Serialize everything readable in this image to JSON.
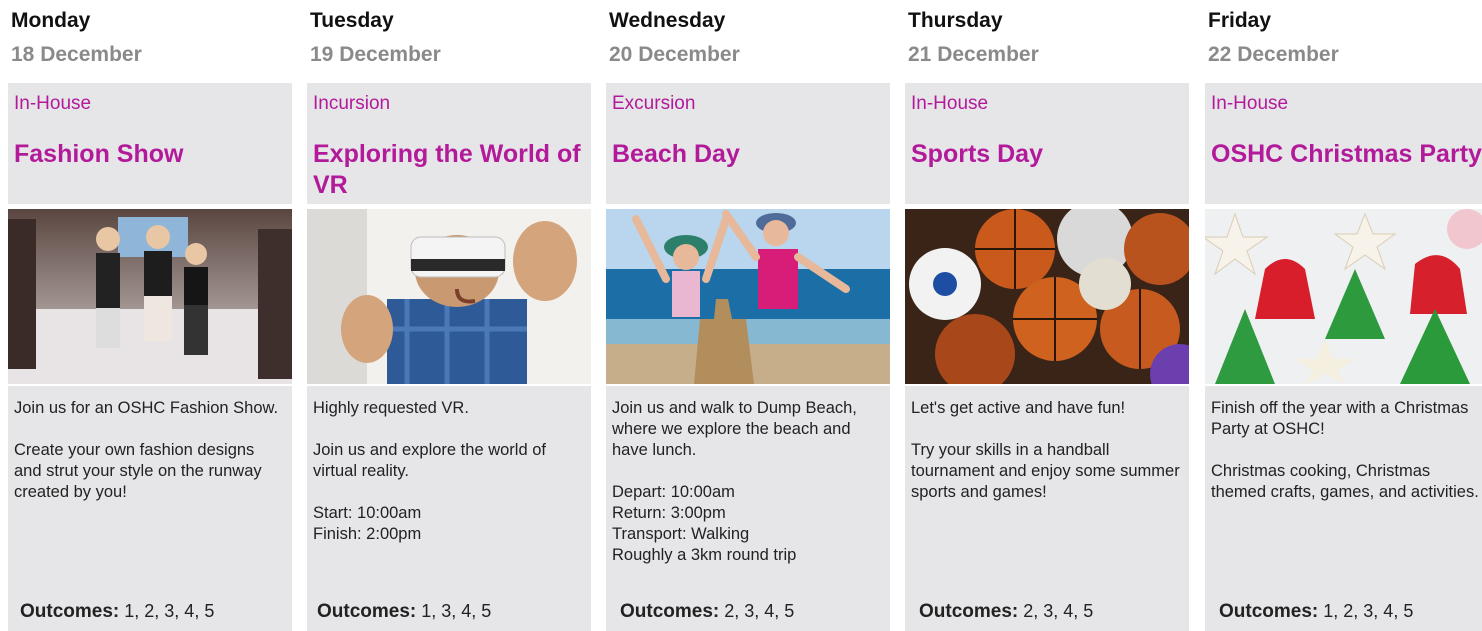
{
  "outcomes_label": "Outcomes:",
  "days": [
    {
      "day": "Monday",
      "date": "18 December",
      "category": "In-House",
      "title": "Fashion Show",
      "image": "kids-fashion-runway-photo",
      "paragraphs": [
        "Join us for an OSHC Fashion Show.",
        "Create your own fashion designs and strut your style on the runway created by you!"
      ],
      "outcomes": "1, 2, 3, 4, 5"
    },
    {
      "day": "Tuesday",
      "date": "19 December",
      "category": "Incursion",
      "title": "Exploring the World of VR",
      "image": "child-vr-headset-photo",
      "paragraphs": [
        "Highly requested VR.",
        "Join us and explore the world of virtual reality.",
        "Start: 10:00am\nFinish: 2:00pm"
      ],
      "outcomes": "1, 3, 4, 5"
    },
    {
      "day": "Wednesday",
      "date": "20 December",
      "category": "Excursion",
      "title": "Beach Day",
      "image": "kids-beach-sandcastle-photo",
      "paragraphs": [
        "Join us and walk to Dump Beach, where we explore the beach and have lunch.",
        "Depart: 10:00am\nReturn: 3:00pm\nTransport: Walking\nRoughly a 3km round trip"
      ],
      "outcomes": "2, 3, 4, 5"
    },
    {
      "day": "Thursday",
      "date": "21 December",
      "category": "In-House",
      "title": "Sports Day",
      "image": "sports-balls-photo",
      "paragraphs": [
        "Let's get active and have fun!",
        "Try your skills in a handball tournament and enjoy some summer sports and games!"
      ],
      "outcomes": "2, 3, 4, 5"
    },
    {
      "day": "Friday",
      "date": "22 December",
      "category": "In-House",
      "title": "OSHC Christmas Party",
      "image": "christmas-cookies-photo",
      "paragraphs": [
        "Finish off the year with a Christmas Party at OSHC!",
        "Christmas cooking, Christmas themed crafts, games, and activities."
      ],
      "outcomes": "1, 2, 3, 4, 5"
    }
  ]
}
